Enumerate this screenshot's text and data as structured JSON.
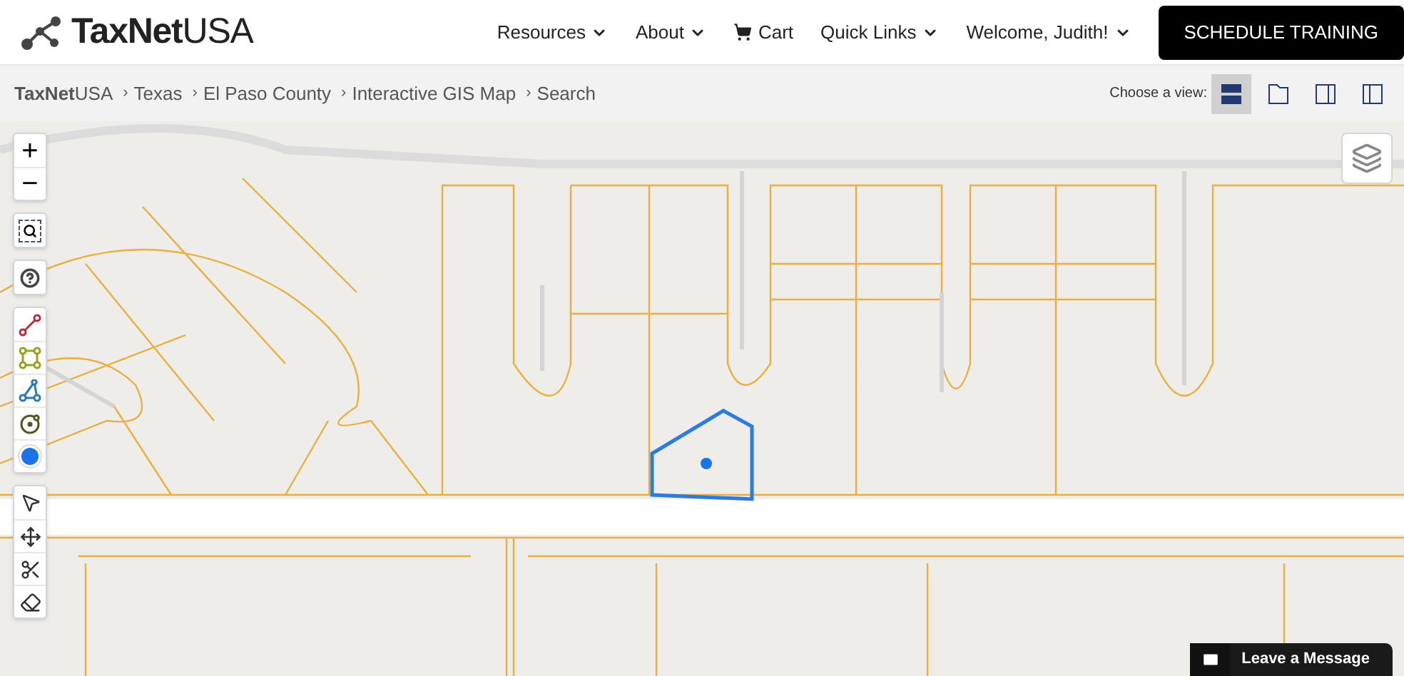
{
  "header": {
    "logo": "**TaxNet**USA",
    "nav": [
      {
        "label": "Resources",
        "kind": "dropdown"
      },
      {
        "label": "About",
        "kind": "dropdown"
      },
      {
        "label": "Cart",
        "kind": "cart"
      },
      {
        "label": "Quick Links",
        "kind": "dropdown"
      },
      {
        "label": "Welcome, Judith!",
        "kind": "dropdown"
      }
    ],
    "cta": "SCHEDULE TRAINING"
  },
  "breadcrumb": {
    "separator": "›",
    "items": [
      "**TaxNet**USA",
      "Texas",
      "El Paso County",
      "Interactive GIS Map",
      "Search"
    ],
    "view_label": "Choose a view:",
    "views": [
      {
        "kind": "split-horizontal",
        "selected": true
      },
      {
        "kind": "single",
        "selected": false
      },
      {
        "kind": "split-right",
        "selected": false
      },
      {
        "kind": "split-left",
        "selected": false
      }
    ]
  },
  "map": {
    "tool_groups": [
      [
        {
          "kind": "zoom-in",
          "label": "+"
        },
        {
          "kind": "zoom-out",
          "label": "−"
        }
      ],
      [
        {
          "kind": "zoom-box"
        }
      ],
      [
        {
          "kind": "help"
        }
      ],
      [
        {
          "kind": "line"
        },
        {
          "kind": "rectangle"
        },
        {
          "kind": "triangle"
        },
        {
          "kind": "circle"
        },
        {
          "kind": "point"
        }
      ],
      [
        {
          "kind": "select"
        },
        {
          "kind": "move"
        },
        {
          "kind": "cut"
        },
        {
          "kind": "erase"
        }
      ]
    ],
    "message_button": "Leave a Message"
  }
}
